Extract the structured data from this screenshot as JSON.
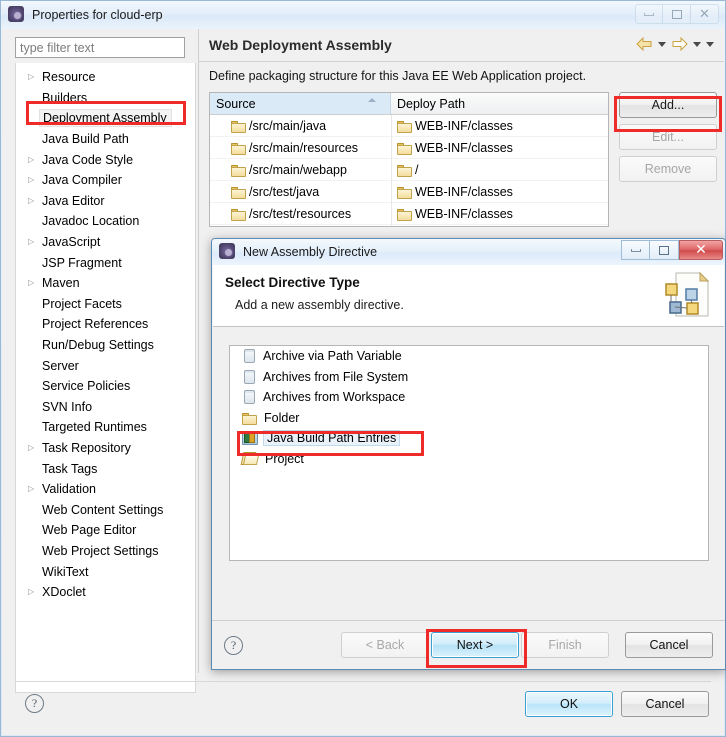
{
  "window": {
    "title": "Properties for cloud-erp",
    "icon": "eclipse-icon",
    "controls": [
      {
        "name": "minimize-button",
        "glyph": "minimize"
      },
      {
        "name": "maximize-button",
        "glyph": "maximize"
      },
      {
        "name": "close-button",
        "glyph": "close"
      }
    ]
  },
  "filter": {
    "placeholder": "type filter text",
    "value": ""
  },
  "tree": {
    "items": [
      {
        "label": "Resource",
        "expandable": true,
        "selected": false
      },
      {
        "label": "Builders",
        "expandable": false,
        "selected": false
      },
      {
        "label": "Deployment Assembly",
        "expandable": false,
        "selected": true
      },
      {
        "label": "Java Build Path",
        "expandable": false,
        "selected": false
      },
      {
        "label": "Java Code Style",
        "expandable": true,
        "selected": false
      },
      {
        "label": "Java Compiler",
        "expandable": true,
        "selected": false
      },
      {
        "label": "Java Editor",
        "expandable": true,
        "selected": false
      },
      {
        "label": "Javadoc Location",
        "expandable": false,
        "selected": false
      },
      {
        "label": "JavaScript",
        "expandable": true,
        "selected": false
      },
      {
        "label": "JSP Fragment",
        "expandable": false,
        "selected": false
      },
      {
        "label": "Maven",
        "expandable": true,
        "selected": false
      },
      {
        "label": "Project Facets",
        "expandable": false,
        "selected": false
      },
      {
        "label": "Project References",
        "expandable": false,
        "selected": false
      },
      {
        "label": "Run/Debug Settings",
        "expandable": false,
        "selected": false
      },
      {
        "label": "Server",
        "expandable": false,
        "selected": false
      },
      {
        "label": "Service Policies",
        "expandable": false,
        "selected": false
      },
      {
        "label": "SVN Info",
        "expandable": false,
        "selected": false
      },
      {
        "label": "Targeted Runtimes",
        "expandable": false,
        "selected": false
      },
      {
        "label": "Task Repository",
        "expandable": true,
        "selected": false
      },
      {
        "label": "Task Tags",
        "expandable": false,
        "selected": false
      },
      {
        "label": "Validation",
        "expandable": true,
        "selected": false
      },
      {
        "label": "Web Content Settings",
        "expandable": false,
        "selected": false
      },
      {
        "label": "Web Page Editor",
        "expandable": false,
        "selected": false
      },
      {
        "label": "Web Project Settings",
        "expandable": false,
        "selected": false
      },
      {
        "label": "WikiText",
        "expandable": false,
        "selected": false
      },
      {
        "label": "XDoclet",
        "expandable": true,
        "selected": false
      }
    ]
  },
  "page": {
    "title": "Web Deployment Assembly",
    "description": "Define packaging structure for this Java EE Web Application project.",
    "nav": {
      "back_icon": "back-arrow-icon",
      "back_menu_icon": "chevron-down-icon",
      "forward_icon": "forward-arrow-icon",
      "forward_menu_icon": "chevron-down-icon",
      "view_menu_icon": "chevron-down-icon"
    },
    "table": {
      "columns": [
        "Source",
        "Deploy Path"
      ],
      "sorted_column": "Source",
      "rows": [
        {
          "source": "/src/main/java",
          "deploy_path": "WEB-INF/classes"
        },
        {
          "source": "/src/main/resources",
          "deploy_path": "WEB-INF/classes"
        },
        {
          "source": "/src/main/webapp",
          "deploy_path": "/"
        },
        {
          "source": "/src/test/java",
          "deploy_path": "WEB-INF/classes"
        },
        {
          "source": "/src/test/resources",
          "deploy_path": "WEB-INF/classes"
        }
      ]
    },
    "buttons": [
      {
        "label": "Add...",
        "enabled": true,
        "highlighted": true
      },
      {
        "label": "Edit...",
        "enabled": false,
        "highlighted": false
      },
      {
        "label": "Remove",
        "enabled": false,
        "highlighted": false
      }
    ]
  },
  "window_footer": {
    "help_icon": "help-icon",
    "ok_label": "OK",
    "cancel_label": "Cancel"
  },
  "dialog": {
    "title": "New Assembly Directive",
    "icon": "eclipse-icon",
    "controls": [
      {
        "name": "minimize-button",
        "glyph": "minimize"
      },
      {
        "name": "maximize-button",
        "glyph": "maximize"
      },
      {
        "name": "close-button",
        "glyph": "close"
      }
    ],
    "banner": {
      "title": "Select Directive Type",
      "subtitle": "Add a new assembly directive.",
      "image": "assembly-wizard-banner-icon"
    },
    "list": [
      {
        "label": "Archive via Path Variable",
        "icon": "jar-icon",
        "selected": false
      },
      {
        "label": "Archives from File System",
        "icon": "jar-icon",
        "selected": false
      },
      {
        "label": "Archives from Workspace",
        "icon": "jar-icon",
        "selected": false
      },
      {
        "label": "Folder",
        "icon": "folder-icon",
        "selected": false
      },
      {
        "label": "Java Build Path Entries",
        "icon": "books-icon",
        "selected": true
      },
      {
        "label": "Project",
        "icon": "project-icon",
        "selected": false
      }
    ],
    "footer": {
      "help_icon": "help-icon",
      "buttons": [
        {
          "label": "< Back",
          "enabled": false,
          "primary": false,
          "highlighted": false
        },
        {
          "label": "Next >",
          "enabled": true,
          "primary": true,
          "highlighted": true
        },
        {
          "label": "Finish",
          "enabled": false,
          "primary": false,
          "highlighted": false
        },
        {
          "label": "Cancel",
          "enabled": true,
          "primary": false,
          "highlighted": false
        }
      ]
    }
  },
  "highlights": [
    {
      "name": "highlight-deployment-assembly",
      "color": "#ef2b29"
    },
    {
      "name": "highlight-add-button",
      "color": "#ef2b29"
    },
    {
      "name": "highlight-java-build-path-entries",
      "color": "#ef2b29"
    },
    {
      "name": "highlight-next-button",
      "color": "#ef2b29"
    }
  ]
}
